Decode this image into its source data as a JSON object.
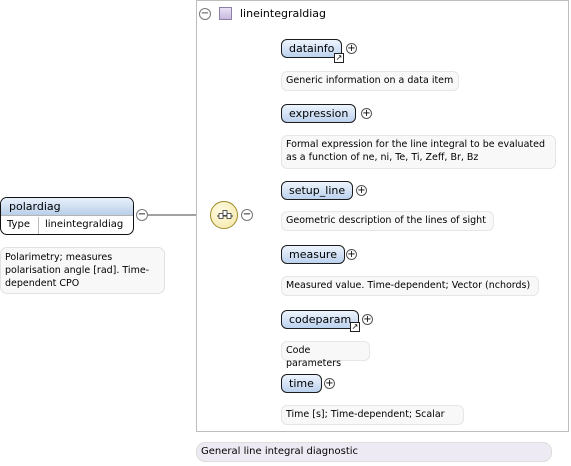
{
  "type_box": {
    "title": "lineintegraldiag",
    "description": "General line integral diagnostic",
    "collapse_symbol": "⊖"
  },
  "root": {
    "name": "polardiag",
    "type_label": "Type",
    "type_value": "lineintegraldiag",
    "description": "Polarimetry; measures polarisation angle [rad]. Time-dependent CPO",
    "collapse_symbol": "⊖"
  },
  "sequence": {
    "collapse_symbol": "⊖"
  },
  "children": [
    {
      "name": "datainfo",
      "has_ref": true,
      "description": "Generic information on a data item"
    },
    {
      "name": "expression",
      "has_ref": false,
      "description": "Formal expression for the line integral to be evaluated as a function of ne, ni, Te, Ti, Zeff, Br, Bz"
    },
    {
      "name": "setup_line",
      "has_ref": false,
      "description": "Geometric description of the lines of sight"
    },
    {
      "name": "measure",
      "has_ref": false,
      "description": "Measured value. Time-dependent; Vector (nchords)"
    },
    {
      "name": "codeparam",
      "has_ref": true,
      "description": "Code parameters"
    },
    {
      "name": "time",
      "has_ref": false,
      "description": "Time [s]; Time-dependent; Scalar"
    }
  ],
  "icons": {
    "expand": "plus-circle-icon",
    "collapse": "minus-circle-icon",
    "reference": "reference-arrow-icon",
    "type": "complex-type-icon",
    "sequence": "sequence-compositor-icon"
  },
  "colors": {
    "element_fill": "#bcd2ee",
    "compositor_fill": "#f3e6a4",
    "type_desc_fill": "#eeeaf4"
  }
}
